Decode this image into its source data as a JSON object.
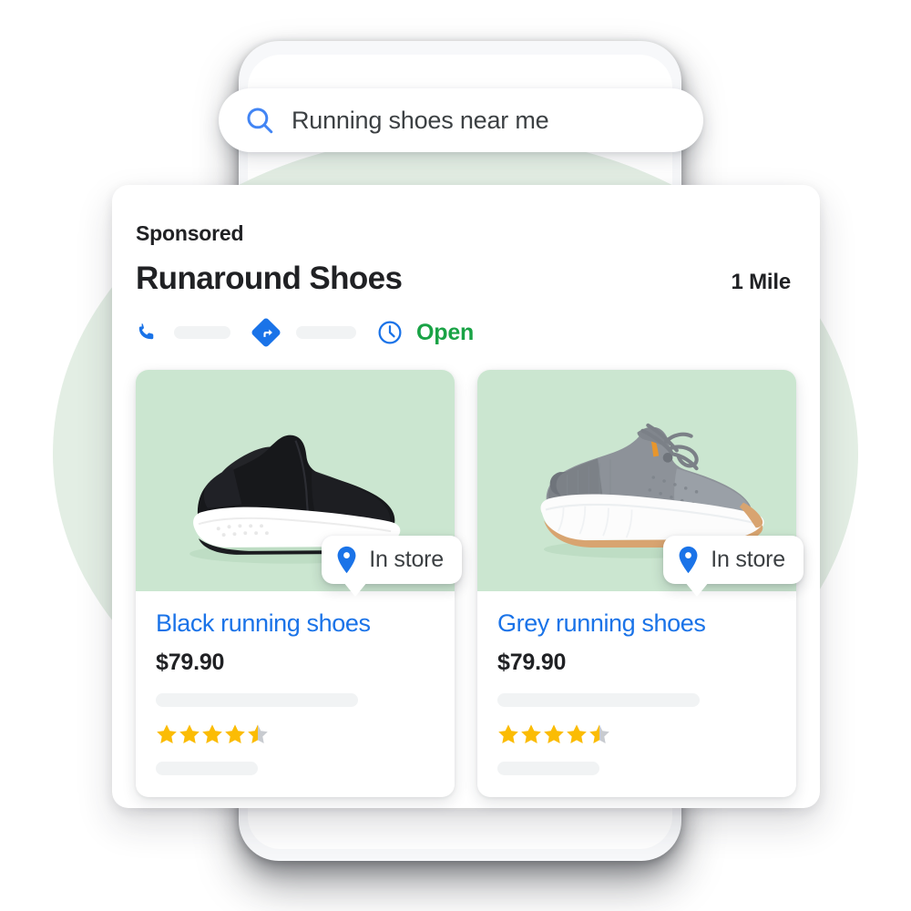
{
  "search": {
    "query": "Running shoes near me",
    "icon": "search-icon"
  },
  "ad": {
    "sponsored_label": "Sponsored",
    "business_name": "Runaround Shoes",
    "distance": "1 Mile",
    "actions": [
      {
        "icon": "phone-icon",
        "label": ""
      },
      {
        "icon": "directions-icon",
        "label": ""
      }
    ],
    "hours": {
      "icon": "clock-icon",
      "status": "Open",
      "status_color": "#1aa346"
    }
  },
  "products": [
    {
      "title": "Black running shoes",
      "price": "$79.90",
      "availability_badge": "In store",
      "availability_icon": "map-pin-icon",
      "rating": 4.5,
      "rating_max": 5,
      "image_alt": "black slip-on running shoe with white sole",
      "image_bg": "#cbe6d0"
    },
    {
      "title": "Grey running shoes",
      "price": "$79.90",
      "availability_badge": "In store",
      "availability_icon": "map-pin-icon",
      "rating": 4.5,
      "rating_max": 5,
      "image_alt": "grey knit running shoe with laces, white midsole and gum outsole",
      "image_bg": "#cbe6d0"
    }
  ],
  "colors": {
    "link_blue": "#1a73e8",
    "brand_blue": "#1a73e8",
    "pin_blue": "#1a73e8",
    "open_green": "#1aa346",
    "star_gold": "#fbbc04",
    "star_empty": "#c8cbd0",
    "halo_green": "#e3eee4",
    "product_bg_green": "#cbe6d0",
    "text_primary": "#202124",
    "text_secondary": "#3c4043",
    "skeleton_gray": "#f1f3f4"
  }
}
